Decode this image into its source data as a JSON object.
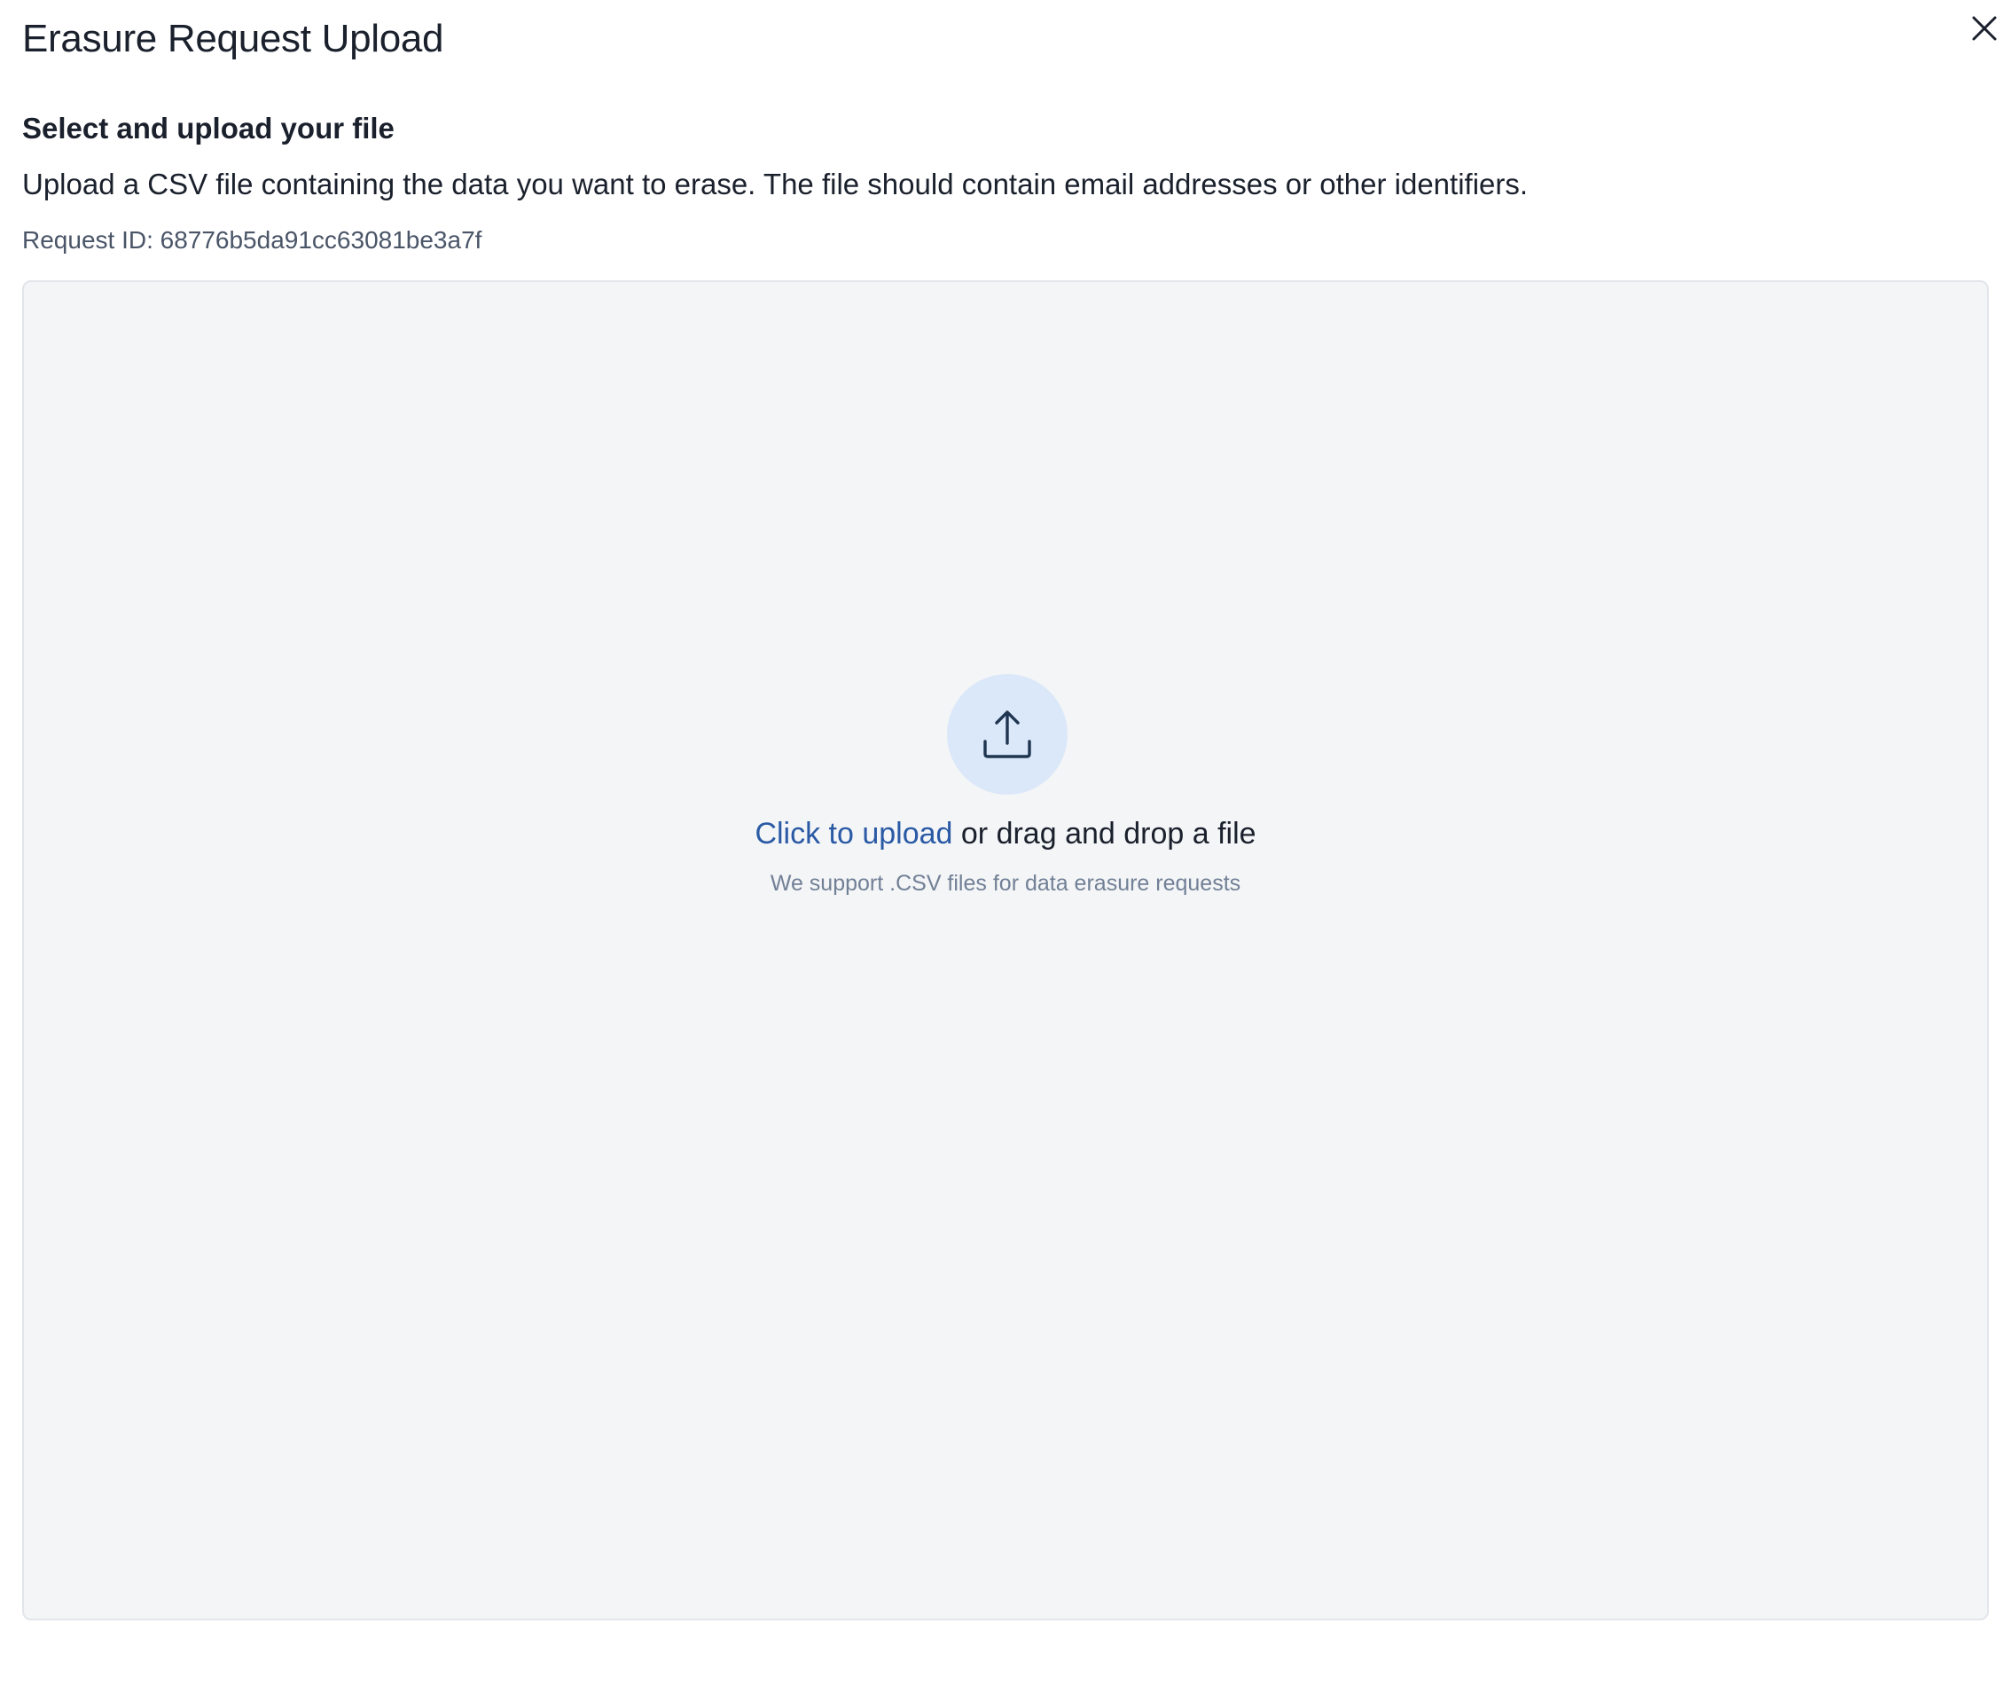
{
  "dialog": {
    "title": "Erasure Request Upload",
    "close_icon": "close-icon"
  },
  "section": {
    "heading": "Select and upload your file",
    "description": "Upload a CSV file containing the data you want to erase. The file should contain email addresses or other identifiers.",
    "request_id": "Request ID: 68776b5da91cc63081be3a7f"
  },
  "dropzone": {
    "icon": "upload-icon",
    "link_label": "Click to upload",
    "cta_suffix": " or drag and drop a file",
    "support_text": "We support .CSV files for data erasure requests"
  },
  "colors": {
    "link": "#2a5aa5",
    "dropzone_bg": "#f4f5f7",
    "icon_circle_bg": "#dbe8f9",
    "muted_text": "#718096"
  }
}
